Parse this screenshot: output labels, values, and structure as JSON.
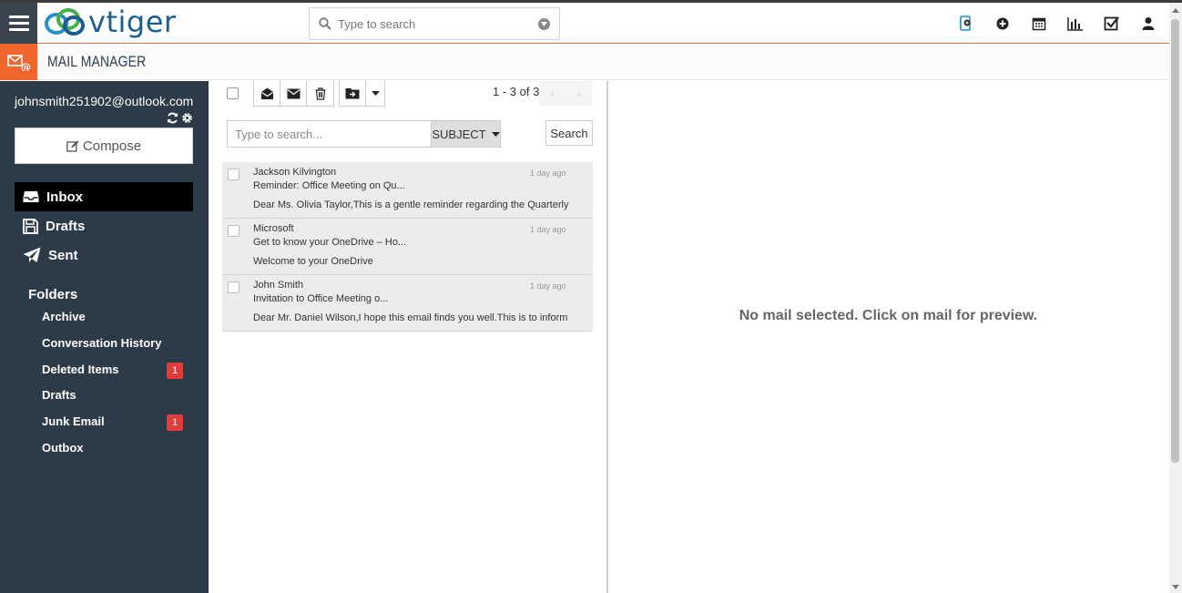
{
  "app": {
    "logo_text": "vtiger",
    "search_placeholder": "Type to search",
    "module_title": "MAIL MANAGER",
    "brand_color": "#f0662d",
    "sidebar_color": "#2c3b47"
  },
  "top_icons": [
    "quick-create-icon",
    "add-icon",
    "calendar-icon",
    "reports-icon",
    "tasks-icon",
    "user-icon"
  ],
  "sidebar": {
    "account": "johnsmith251902@outlook.com",
    "compose_label": "Compose",
    "main_folders": [
      {
        "label": "Inbox",
        "icon": "inbox-icon",
        "active": true
      },
      {
        "label": "Drafts",
        "icon": "save-icon",
        "active": false
      },
      {
        "label": "Sent",
        "icon": "paper-plane-icon",
        "active": false
      }
    ],
    "folders_title": "Folders",
    "folders": [
      {
        "label": "Archive",
        "badge": ""
      },
      {
        "label": "Conversation History",
        "badge": ""
      },
      {
        "label": "Deleted Items",
        "badge": "1"
      },
      {
        "label": "Drafts",
        "badge": ""
      },
      {
        "label": "Junk Email",
        "badge": "1"
      },
      {
        "label": "Outbox",
        "badge": ""
      }
    ]
  },
  "list": {
    "pager_text": "1 - 3 of 3",
    "search_placeholder": "Type to search...",
    "search_field": "SUBJECT",
    "search_button": "Search",
    "mails": [
      {
        "from": "Jackson Kilvington",
        "time": "1 day ago",
        "subject": "Reminder: Office Meeting on Qu...",
        "snippet": "Dear Ms. Olivia Taylor,This is a gentle reminder regarding the Quarterly"
      },
      {
        "from": "Microsoft",
        "time": "1 day ago",
        "subject": "Get to know your OneDrive – Ho...",
        "snippet": "Welcome to your OneDrive"
      },
      {
        "from": "John Smith",
        "time": "1 day ago",
        "subject": "Invitation to Office Meeting o...",
        "snippet": "Dear Mr. Daniel Wilson,I hope this email finds you well.This is to inform"
      }
    ]
  },
  "preview": {
    "empty_message": "No mail selected. Click on mail for preview."
  }
}
